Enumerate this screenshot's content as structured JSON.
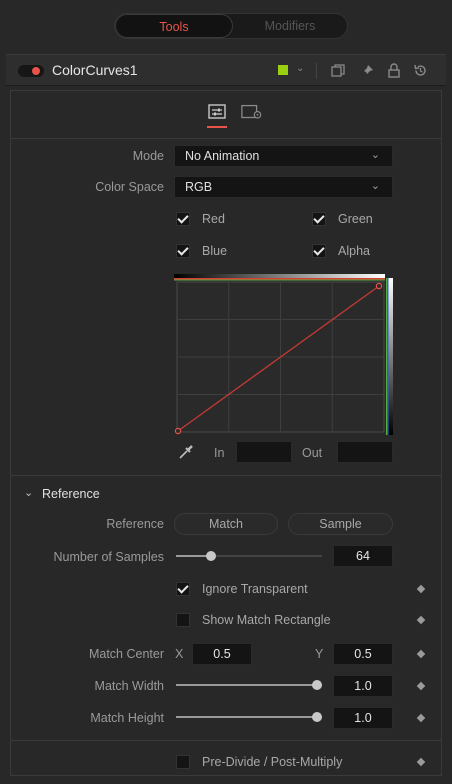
{
  "tabs": {
    "active": "Tools",
    "inactive": "Modifiers"
  },
  "node": {
    "title": "ColorCurves1",
    "color": "#9ad011"
  },
  "controls": {
    "mode_label": "Mode",
    "mode_value": "No Animation",
    "colorspace_label": "Color Space",
    "colorspace_value": "RGB",
    "channels": [
      {
        "label": "Red",
        "checked": true
      },
      {
        "label": "Green",
        "checked": true
      },
      {
        "label": "Blue",
        "checked": true
      },
      {
        "label": "Alpha",
        "checked": true
      }
    ],
    "in_label": "In",
    "out_label": "Out",
    "in_value": "",
    "out_value": ""
  },
  "reference": {
    "section_label": "Reference",
    "reference_label": "Reference",
    "match_button": "Match",
    "sample_button": "Sample",
    "samples_label": "Number of Samples",
    "samples_value": "64",
    "samples_fraction": 0.24,
    "ignore_transparent_label": "Ignore Transparent",
    "ignore_transparent_checked": true,
    "show_match_rect_label": "Show Match Rectangle",
    "show_match_rect_checked": false,
    "match_center_label": "Match Center",
    "x_label": "X",
    "x_value": "0.5",
    "y_label": "Y",
    "y_value": "0.5",
    "match_width_label": "Match Width",
    "match_width_value": "1.0",
    "match_width_fraction": 1.0,
    "match_height_label": "Match Height",
    "match_height_value": "1.0",
    "match_height_fraction": 1.0
  },
  "footer": {
    "predivide_label": "Pre-Divide / Post-Multiply",
    "predivide_checked": false
  },
  "colors": {
    "accent": "#e8534a",
    "curve": "#c63a34"
  }
}
